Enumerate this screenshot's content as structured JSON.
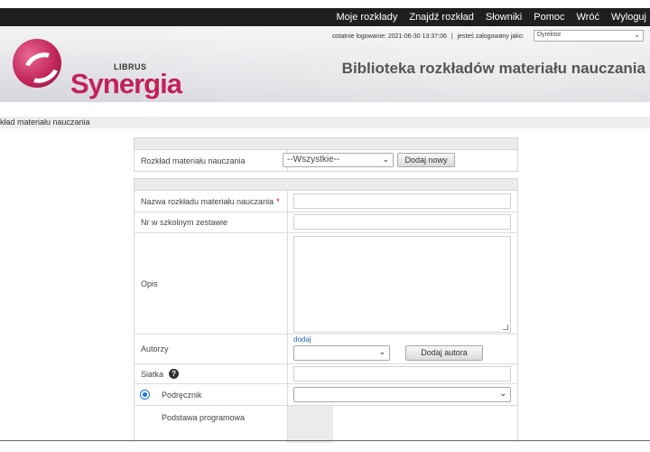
{
  "topnav": {
    "items": [
      "Moje rozkłady",
      "Znajdź rozkład",
      "Słowniki",
      "Pomoc",
      "Wróć",
      "Wyloguj"
    ]
  },
  "header": {
    "brand_small": "LIBRUS",
    "brand_name": "Synergia",
    "last_login_label": "ostatnie logowanie: 2021-06-30 13:37:06",
    "separator": "|",
    "logged_as_label": "jesteś zalogowany jako:",
    "role_selected": "Dyrektor",
    "title": "Biblioteka rozkładów materiału nauczania",
    "brand_color": "#c2215a"
  },
  "breadcrumb": {
    "text": "kład materiału nauczania"
  },
  "select_panel": {
    "label": "Rozkład materiału nauczania",
    "select_value": "--Wszystkie--",
    "new_button": "Dodaj nowy"
  },
  "form": {
    "name_label": "Nazwa rozkładu materiału nauczania",
    "required_mark": "*",
    "number_label": "Nr w szkolnym zestawie",
    "description_label": "Opis",
    "authors_label": "Autorzy",
    "authors_add_link": "dodaj",
    "add_author_button": "Dodaj autora",
    "grid_label": "Siatka",
    "help_glyph": "?",
    "textbook_label": "Podręcznik",
    "curriculum_label": "Podstawa programowa"
  },
  "icons": {
    "chevron": "chevron-down-icon",
    "help": "help-icon"
  }
}
